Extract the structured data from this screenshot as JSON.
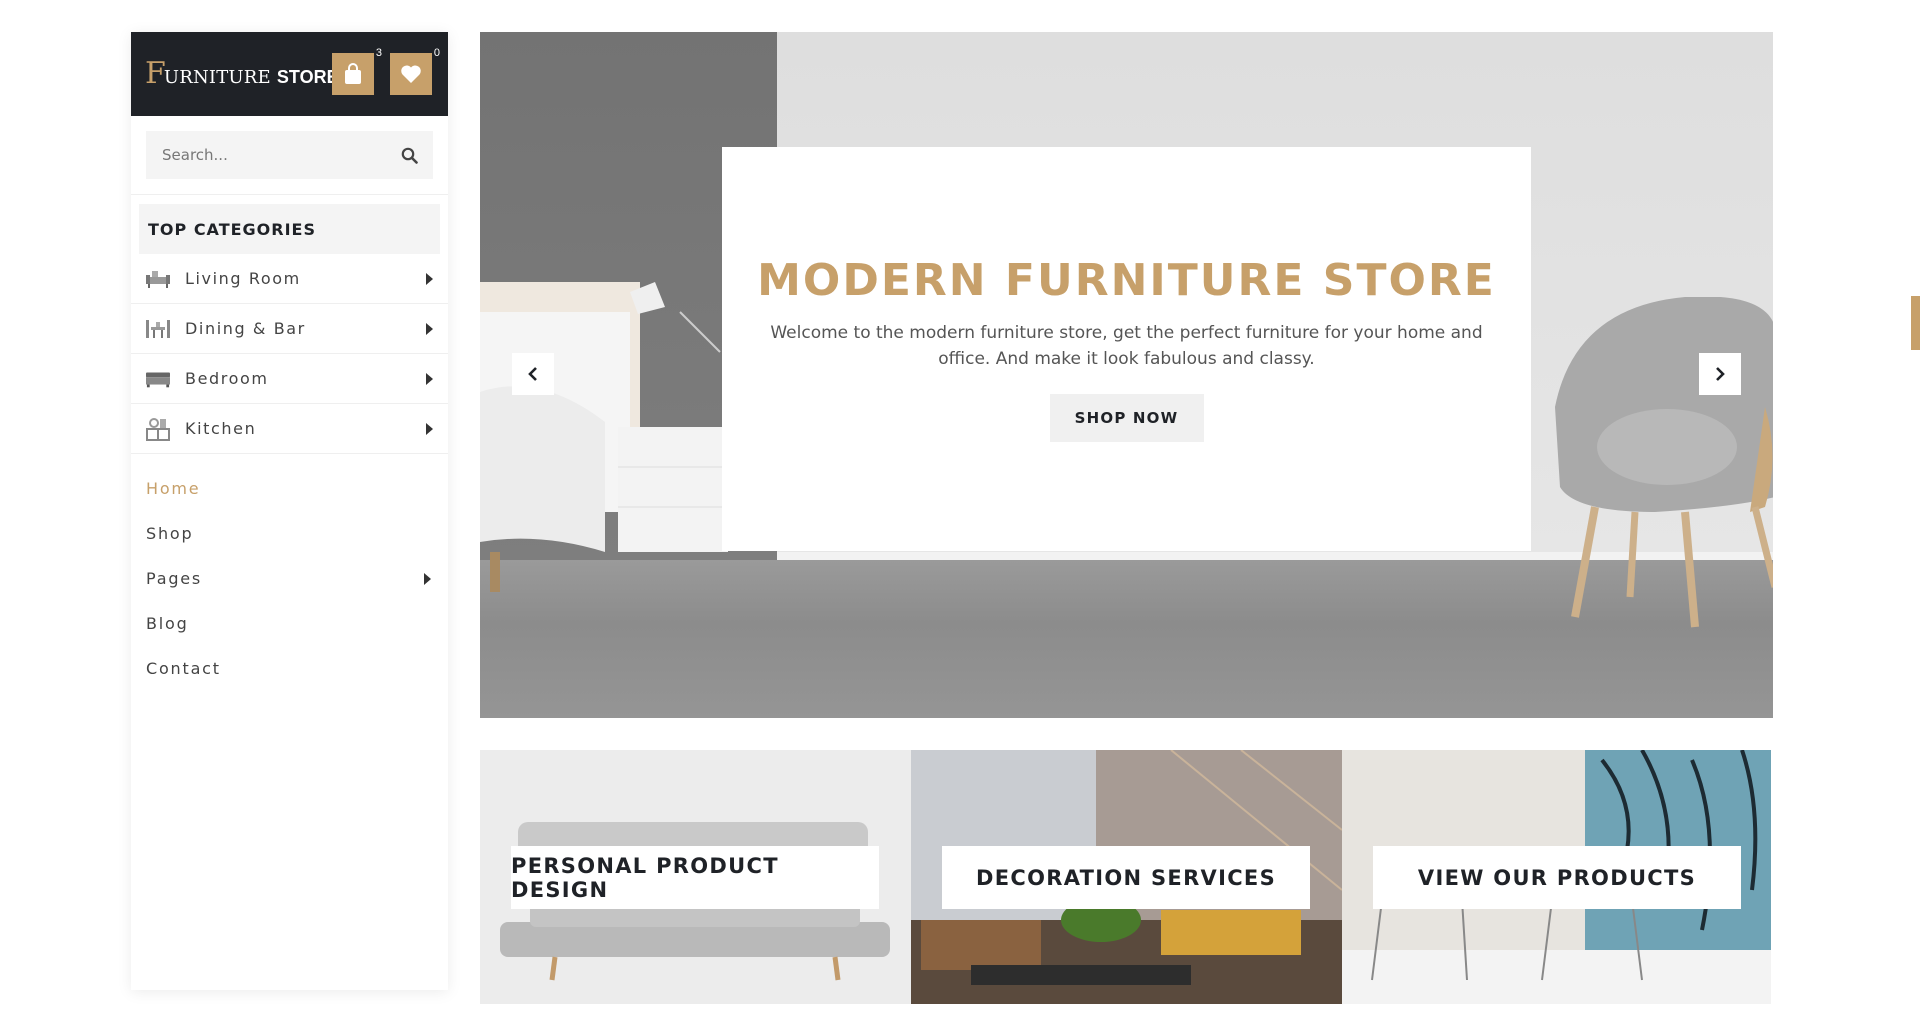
{
  "brand": {
    "logo_initial": "F",
    "logo_word1": "URNITURE",
    "logo_word2": "STORE",
    "cart_count": "3",
    "wishlist_count": "0"
  },
  "search": {
    "placeholder": "Search..."
  },
  "categories": {
    "heading": "TOP CATEGORIES",
    "items": [
      {
        "label": "Living Room",
        "icon": "sofa-icon"
      },
      {
        "label": "Dining & Bar",
        "icon": "dining-icon"
      },
      {
        "label": "Bedroom",
        "icon": "bed-icon"
      },
      {
        "label": "Kitchen",
        "icon": "kitchen-icon"
      }
    ]
  },
  "nav": {
    "items": [
      {
        "label": "Home",
        "active": true
      },
      {
        "label": "Shop"
      },
      {
        "label": "Pages",
        "has_submenu": true
      },
      {
        "label": "Blog"
      },
      {
        "label": "Contact"
      }
    ]
  },
  "hero": {
    "title": "MODERN FURNITURE STORE",
    "text": "Welcome to the modern furniture store, get the perfect furniture for your home and office. And make it look fabulous and classy.",
    "button": "SHOP NOW"
  },
  "banners": [
    {
      "label": "PERSONAL PRODUCT DESIGN"
    },
    {
      "label": "DECORATION SERVICES"
    },
    {
      "label": "VIEW OUR PRODUCTS"
    }
  ],
  "colors": {
    "accent": "#c7a06a",
    "dark": "#1f2227",
    "light_bg": "#f4f4f4"
  }
}
